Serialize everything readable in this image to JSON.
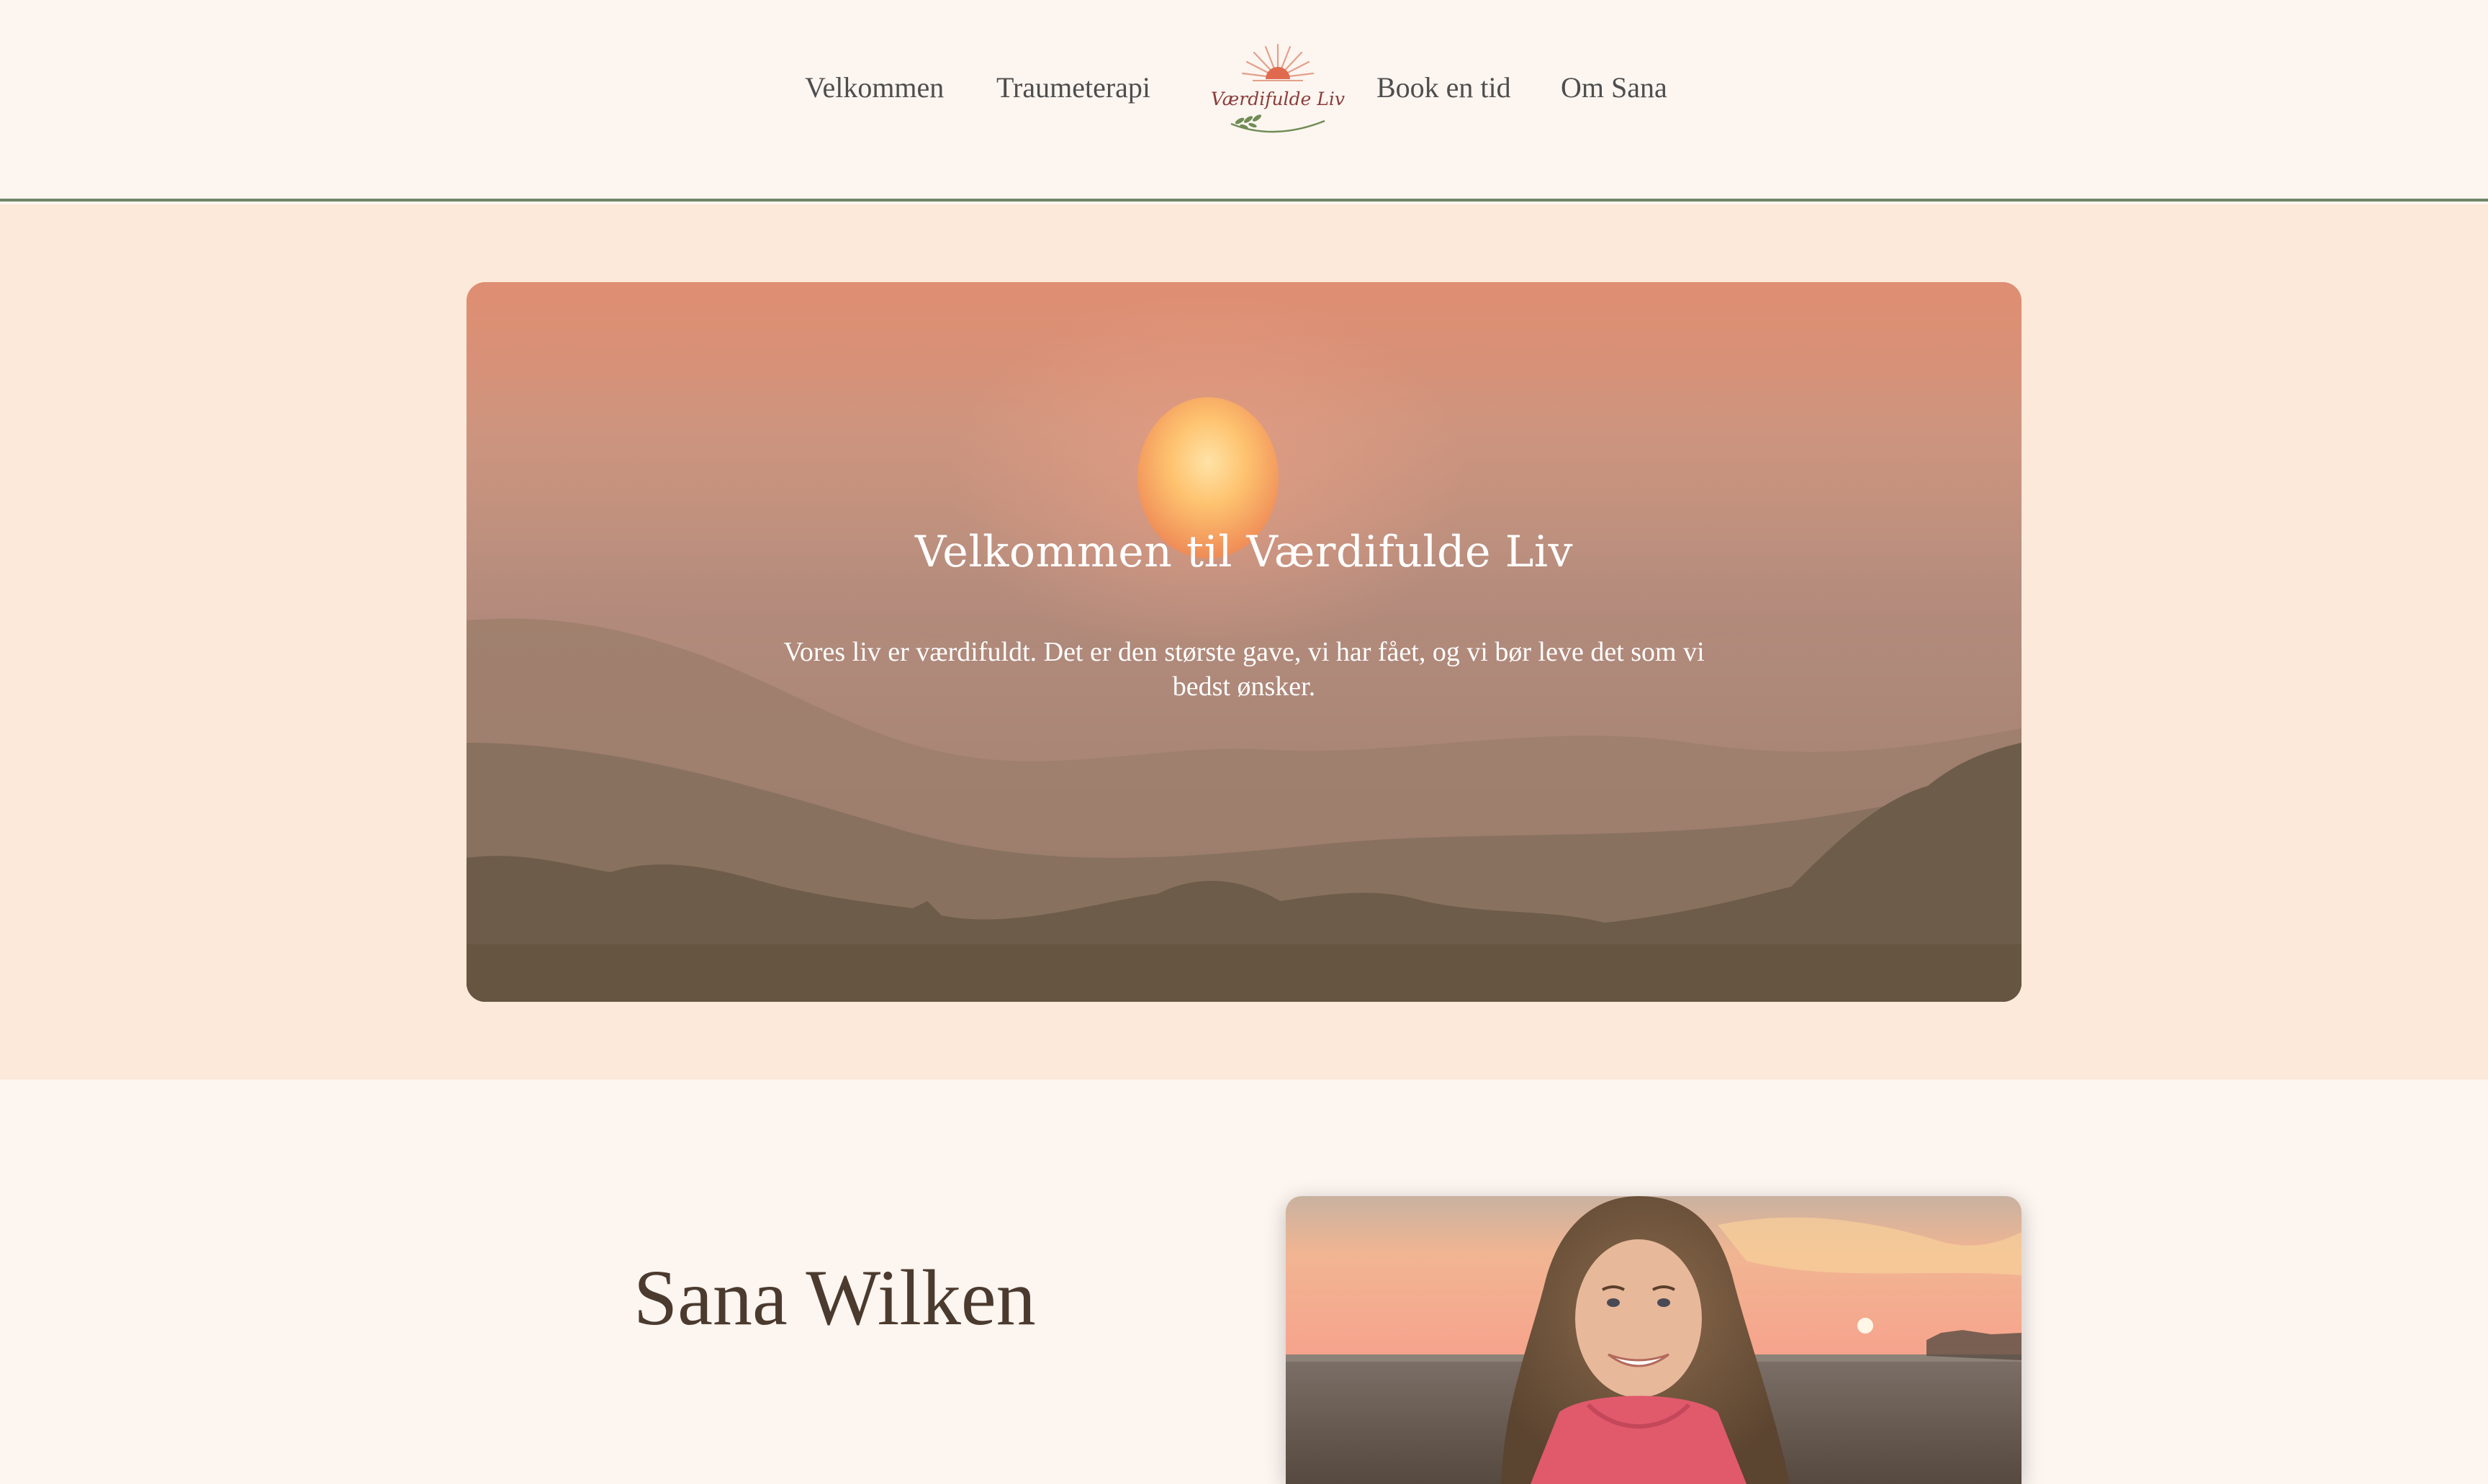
{
  "nav": {
    "items": [
      {
        "label": "Velkommen"
      },
      {
        "label": "Traumeterapi"
      },
      {
        "label": "Book en tid"
      },
      {
        "label": "Om Sana"
      }
    ],
    "logo": {
      "text": "Værdifulde Liv",
      "icon": "sunrise-leaf-logo"
    }
  },
  "hero": {
    "title": "Velkommen til Værdifulde Liv",
    "text": "Vores liv er værdifuldt. Det er den største gave, vi har fået, og vi bør leve det som vi bedst ønsker."
  },
  "about": {
    "name": "Sana Wilken"
  },
  "colors": {
    "page_bg": "#fcf5f0",
    "hero_band": "#fde9d9",
    "nav_border": "#6f8567",
    "heading": "#4b3a2e"
  }
}
